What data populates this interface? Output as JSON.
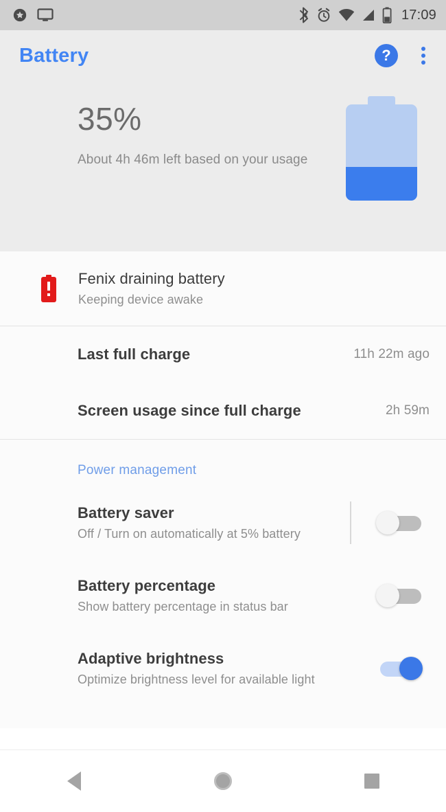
{
  "status_bar": {
    "left_icons": [
      "priority-star-icon",
      "cast-screen-icon"
    ],
    "right_icons": [
      "bluetooth-icon",
      "alarm-icon",
      "wifi-icon",
      "cell-signal-icon",
      "battery-icon"
    ],
    "clock": "17:09"
  },
  "app_bar": {
    "title": "Battery",
    "help_glyph": "?",
    "help_name": "help-icon",
    "overflow_name": "overflow-menu-icon",
    "accent_color": "#4285f4"
  },
  "summary": {
    "percent": "35%",
    "estimate": "About 4h 46m left based on your usage",
    "battery_level_percent": 35,
    "battery_body_color": "#b7cef2",
    "battery_fill_color": "#3b7ded"
  },
  "alert": {
    "icon_name": "battery-alert-icon",
    "icon_color": "#e21b1b",
    "title": "Fenix draining battery",
    "subtitle": "Keeping device awake"
  },
  "stats": [
    {
      "label": "Last full charge",
      "value": "11h 22m ago"
    },
    {
      "label": "Screen usage since full charge",
      "value": "2h 59m"
    }
  ],
  "power_management": {
    "header": "Power management",
    "header_color": "#6f9de8",
    "settings": [
      {
        "title": "Battery saver",
        "subtitle": "Off / Turn on automatically at 5% battery",
        "toggle_state": "off",
        "has_divider": true
      },
      {
        "title": "Battery percentage",
        "subtitle": "Show battery percentage in status bar",
        "toggle_state": "off",
        "has_divider": false
      },
      {
        "title": "Adaptive brightness",
        "subtitle": "Optimize brightness level for available light",
        "toggle_state": "on",
        "has_divider": false
      }
    ]
  },
  "nav_bar": {
    "back": "back-button",
    "home": "home-button",
    "recents": "recents-button"
  }
}
